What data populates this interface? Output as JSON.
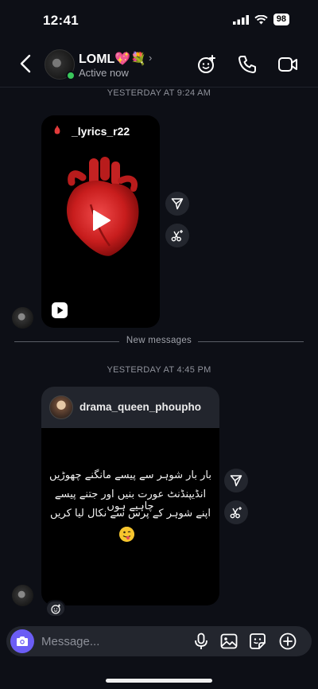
{
  "status_bar": {
    "time": "12:41",
    "battery": "98"
  },
  "header": {
    "name": "LOML💖💐",
    "status": "Active now",
    "chevron": "›",
    "icons": [
      "back-chevron-icon",
      "effects-sticker-icon",
      "phone-icon",
      "video-camera-icon"
    ]
  },
  "thread": {
    "timestamp_1": "YESTERDAY AT 9:24 AM",
    "reel": {
      "username": "_lyrics_r22"
    },
    "divider": "New messages",
    "timestamp_2": "YESTERDAY AT 4:45 PM",
    "post": {
      "username": "drama_queen_phoupho",
      "lines": [
        "بار بار شوہر سے پیسے مانگنے چھوڑیں",
        "انڈیپنڈنٹ عورت بنیں اور جتنے پیسے چاہیے ہوں",
        "اپنے شوہر کے پرس سے نکال لیا کریں"
      ]
    }
  },
  "composer": {
    "placeholder": "Message..."
  },
  "colors": {
    "background": "#0d0f16",
    "accent": "#6b5df5",
    "online": "#3ac75b",
    "bubble": "#23262e"
  }
}
